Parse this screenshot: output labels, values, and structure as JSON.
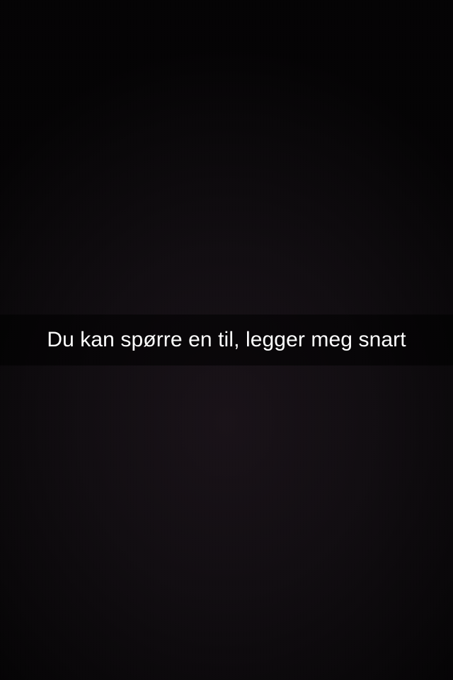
{
  "snap": {
    "caption": "Du kan spørre en til, legger meg snart"
  },
  "colors": {
    "background": "#0b090c",
    "caption_bar": "rgba(0,0,0,0.55)",
    "caption_text": "#ffffff"
  }
}
